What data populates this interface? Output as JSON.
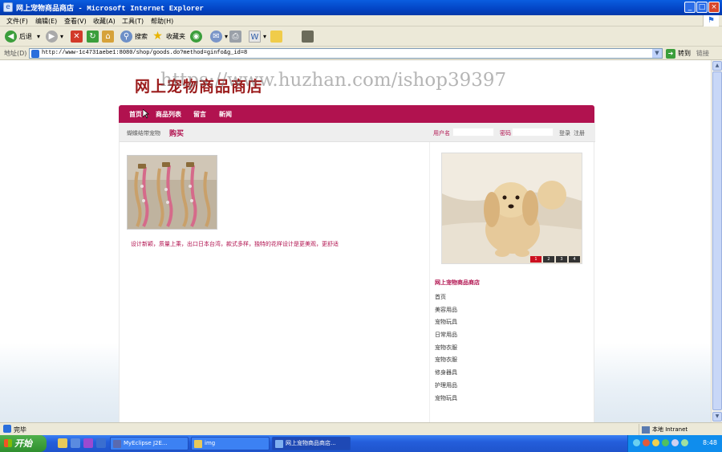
{
  "window": {
    "title": "网上宠物商品商店 - Microsoft Internet Explorer",
    "minimize": "_",
    "maximize": "□",
    "close": "×"
  },
  "menu": [
    "文件(F)",
    "编辑(E)",
    "查看(V)",
    "收藏(A)",
    "工具(T)",
    "帮助(H)"
  ],
  "toolbar": {
    "back": "后退",
    "search": "搜索",
    "favorites": "收藏夹"
  },
  "address": {
    "label": "地址(D)",
    "url": "http://www-1c4731aebe1:8080/shop/goods.do?method=ginfo&g_id=8",
    "go": "转到",
    "links": "链接"
  },
  "site": {
    "logo": "网上宠物商品商店",
    "watermark": "https://www.huzhan.com/ishop39397",
    "nav": [
      "首页",
      "商品列表",
      "留言",
      "新闻"
    ]
  },
  "product": {
    "name": "蝴蝶结带宠物",
    "buy_label": "购买",
    "description": "设计新颖，质量上乘，出口日本台湾，款式多样，独特的花样设计是更美观，更舒适"
  },
  "login": {
    "username_label": "用户名",
    "password_label": "密码",
    "login_action": "登录",
    "register_action": "注册"
  },
  "slider": {
    "pages": [
      "1",
      "2",
      "3",
      "4"
    ],
    "active_page": 1
  },
  "sidebar": {
    "title": "网上宠物商品商店",
    "categories": [
      "首页",
      "美容用品",
      "宠物玩具",
      "日常用品",
      "宠物衣服",
      "宠物衣服",
      "修身器具",
      "护理用品",
      "宠物玩具"
    ]
  },
  "status": {
    "text": "完毕",
    "zone": "本地 Intranet"
  },
  "taskbar": {
    "start": "开始",
    "tasks": [
      "MyEclipse J2E...",
      "img",
      "网上宠物商品商店..."
    ],
    "clock": "8:48"
  },
  "colors": {
    "accent": "#b1124f",
    "logo": "#9b1c1c"
  }
}
